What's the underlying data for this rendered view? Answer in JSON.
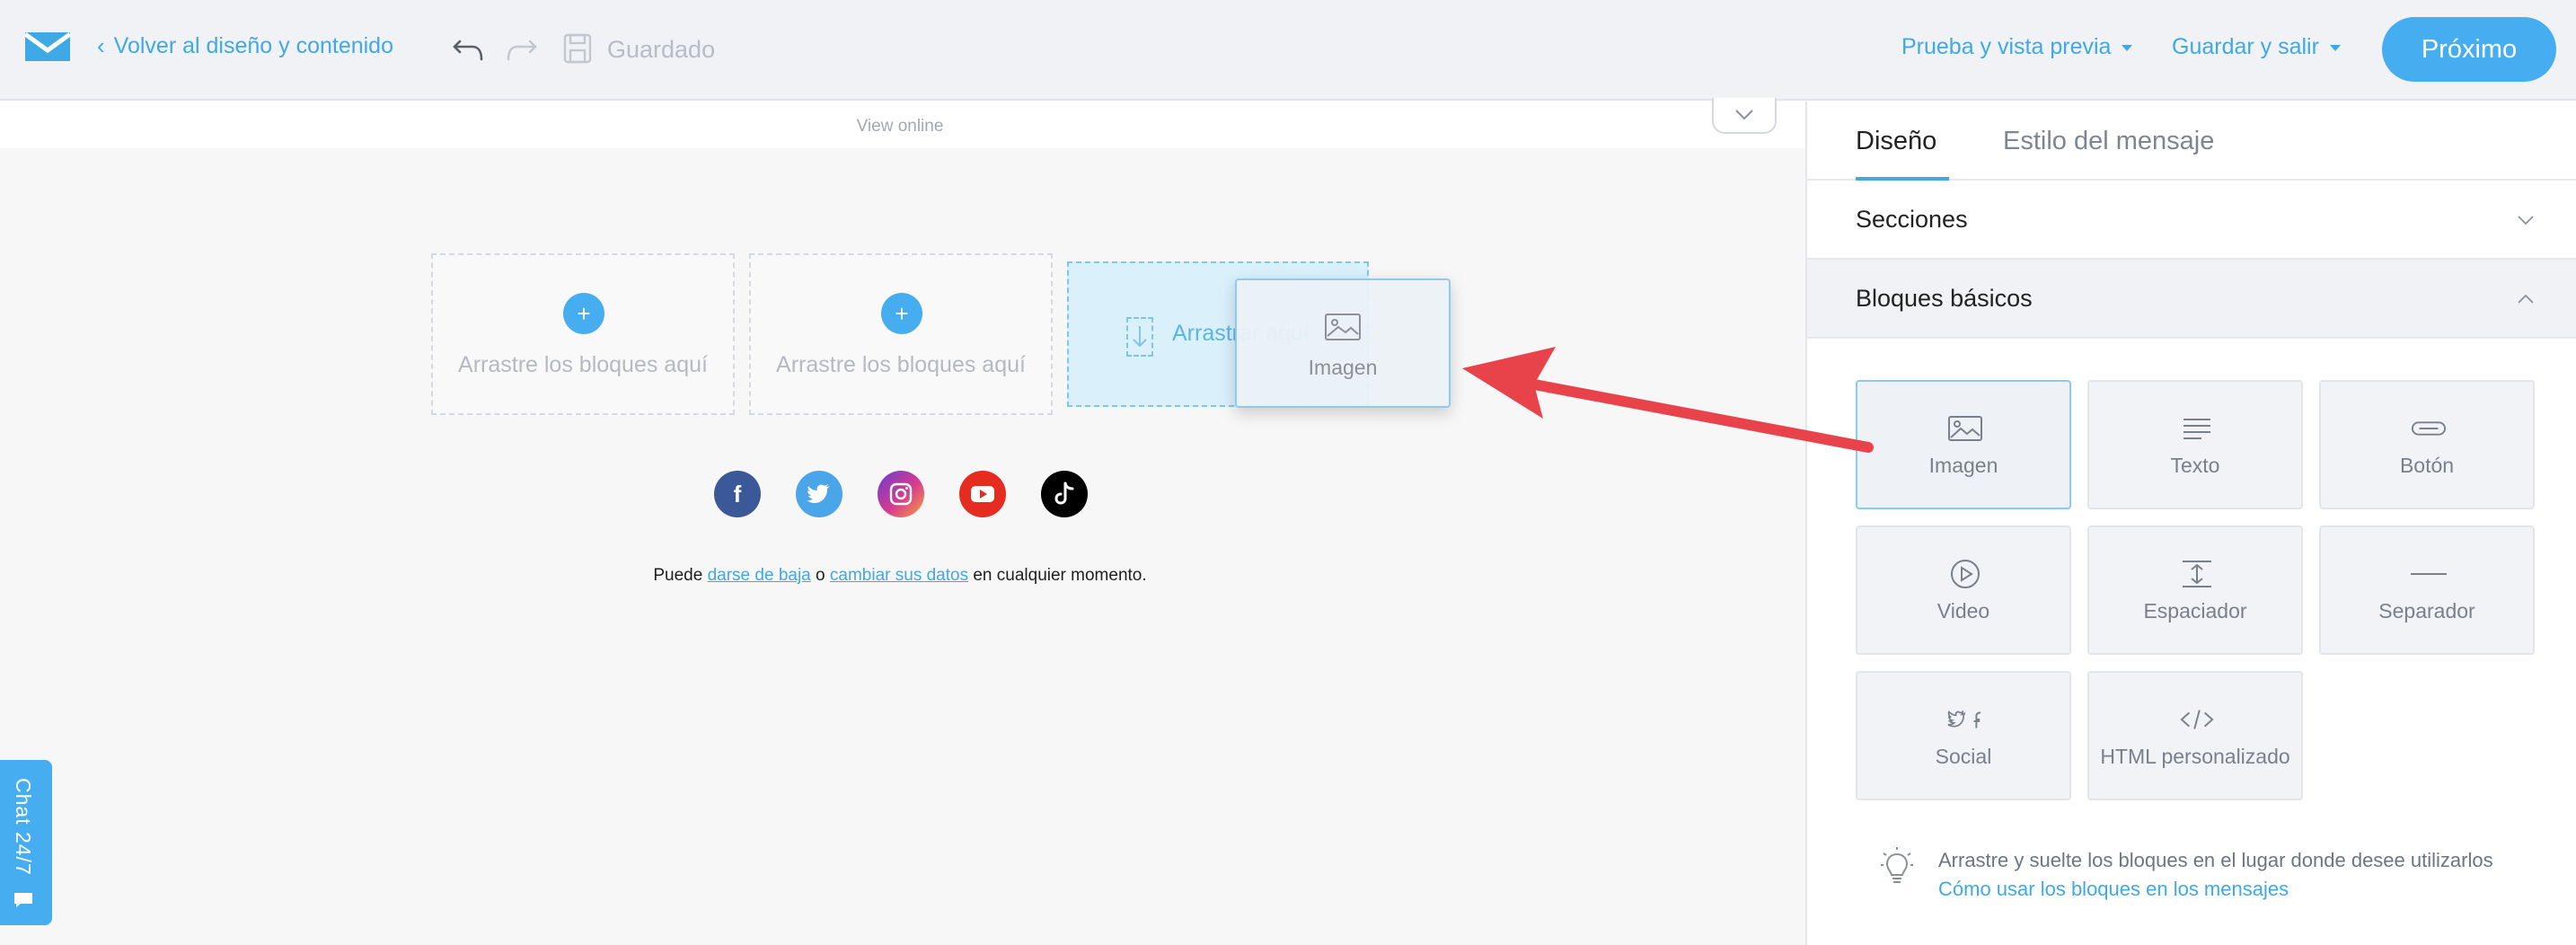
{
  "topbar": {
    "back_label": "Volver al diseño y contenido",
    "saved_label": "Guardado",
    "preview_menu": "Prueba y vista previa",
    "save_exit_menu": "Guardar y salir",
    "next_button": "Próximo"
  },
  "canvas": {
    "view_online": "View online",
    "drop_zones": [
      {
        "label": "Arrastre los bloques aquí"
      },
      {
        "label": "Arrastre los bloques aquí"
      }
    ],
    "active_drop_label": "Arrastrar aquí",
    "drag_ghost_label": "Imagen",
    "socials": [
      "facebook-icon",
      "twitter-icon",
      "instagram-icon",
      "youtube-icon",
      "tiktok-icon"
    ],
    "footer": {
      "prefix": "Puede",
      "unsubscribe_link": "darse de baja",
      "middle": "o",
      "change_data_link": "cambiar sus datos",
      "suffix": "en cualquier momento."
    }
  },
  "chat": {
    "label": "Chat 24/7"
  },
  "panel": {
    "tabs": [
      {
        "label": "Diseño",
        "active": true
      },
      {
        "label": "Estilo del mensaje",
        "active": false
      }
    ],
    "sections_label": "Secciones",
    "basics_label": "Bloques básicos",
    "blocks": [
      {
        "label": "Imagen",
        "icon": "image-icon",
        "selected": true
      },
      {
        "label": "Texto",
        "icon": "text-icon"
      },
      {
        "label": "Botón",
        "icon": "button-icon"
      },
      {
        "label": "Video",
        "icon": "video-icon"
      },
      {
        "label": "Espaciador",
        "icon": "spacer-icon"
      },
      {
        "label": "Separador",
        "icon": "separator-icon"
      },
      {
        "label": "Social",
        "icon": "social-icon"
      },
      {
        "label": "HTML personalizado",
        "icon": "html-icon"
      }
    ],
    "tip_text": "Arrastre y suelte los bloques en el lugar donde desee utilizarlos",
    "tip_link": "Cómo usar los bloques en los mensajes"
  },
  "colors": {
    "accent": "#46aef0",
    "link": "#3fa9e6",
    "annotation_arrow": "#e8434a"
  }
}
